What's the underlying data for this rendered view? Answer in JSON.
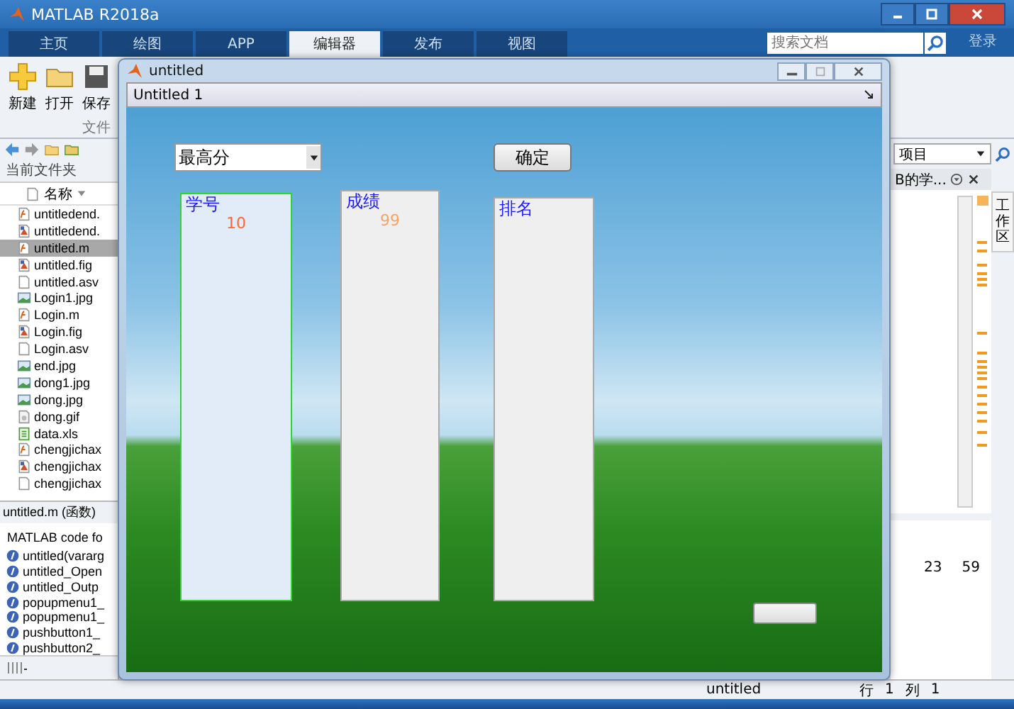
{
  "app": {
    "title": "MATLAB R2018a"
  },
  "tabs": [
    {
      "label": "主页",
      "selected": false
    },
    {
      "label": "绘图",
      "selected": false
    },
    {
      "label": "APP",
      "selected": false
    },
    {
      "label": "编辑器",
      "selected": true
    },
    {
      "label": "发布",
      "selected": false
    },
    {
      "label": "视图",
      "selected": false
    }
  ],
  "search": {
    "placeholder": "搜索文档"
  },
  "login": "登录",
  "toolbar": [
    {
      "label": "新建",
      "kind": "new"
    },
    {
      "label": "打开",
      "kind": "open"
    },
    {
      "label": "保存",
      "kind": "save"
    }
  ],
  "toolbar_section": "文件",
  "current_folder": {
    "title": "当前文件夹",
    "column": "名称",
    "files": [
      {
        "name": "untitledend.",
        "kind": "code",
        "selected": false
      },
      {
        "name": "untitledend.",
        "kind": "fig",
        "selected": false
      },
      {
        "name": "untitled.m",
        "kind": "code",
        "selected": true
      },
      {
        "name": "untitled.fig",
        "kind": "fig",
        "selected": false
      },
      {
        "name": "untitled.asv",
        "kind": "doc",
        "selected": false
      },
      {
        "name": "Login1.jpg",
        "kind": "image",
        "selected": false
      },
      {
        "name": "Login.m",
        "kind": "code",
        "selected": false
      },
      {
        "name": "Login.fig",
        "kind": "fig",
        "selected": false
      },
      {
        "name": "Login.asv",
        "kind": "doc",
        "selected": false
      },
      {
        "name": "end.jpg",
        "kind": "image",
        "selected": false
      },
      {
        "name": "dong1.jpg",
        "kind": "image",
        "selected": false
      },
      {
        "name": "dong.jpg",
        "kind": "image",
        "selected": false
      },
      {
        "name": "dong.gif",
        "kind": "gif",
        "selected": false
      },
      {
        "name": "data.xls",
        "kind": "sheet",
        "selected": false
      },
      {
        "name": "chengjichax",
        "kind": "code",
        "selected": false
      },
      {
        "name": "chengjichax",
        "kind": "fig",
        "selected": false
      },
      {
        "name": "chengjichax",
        "kind": "doc",
        "selected": false
      }
    ]
  },
  "details": {
    "title": "untitled.m (函数)",
    "description": "MATLAB code fo",
    "functions": [
      "untitled(vararg",
      "untitled_Open",
      "untitled_Outp",
      "popupmenu1_",
      "popupmenu1_",
      "pushbutton1_",
      "pushbutton2_"
    ]
  },
  "right_panel": {
    "dropdown": "项目",
    "tab": "B的学...",
    "side_tab": "工作区",
    "values": [
      "23",
      "59"
    ]
  },
  "status_bar": {
    "file": "untitled",
    "row_label": "行",
    "row": "1",
    "col_label": "列",
    "col": "1"
  },
  "figure": {
    "title": "untitled",
    "panel_title": "Untitled 1",
    "popup": {
      "value": "最高分"
    },
    "button": "确定",
    "lists": [
      {
        "title": "学号",
        "selected": true,
        "items": [
          {
            "text": "10",
            "color": "#ff6633"
          }
        ]
      },
      {
        "title": "成绩",
        "selected": false,
        "items": [
          {
            "text": "99",
            "color": "#f4a460"
          }
        ]
      },
      {
        "title": "排名",
        "selected": false
      }
    ]
  }
}
